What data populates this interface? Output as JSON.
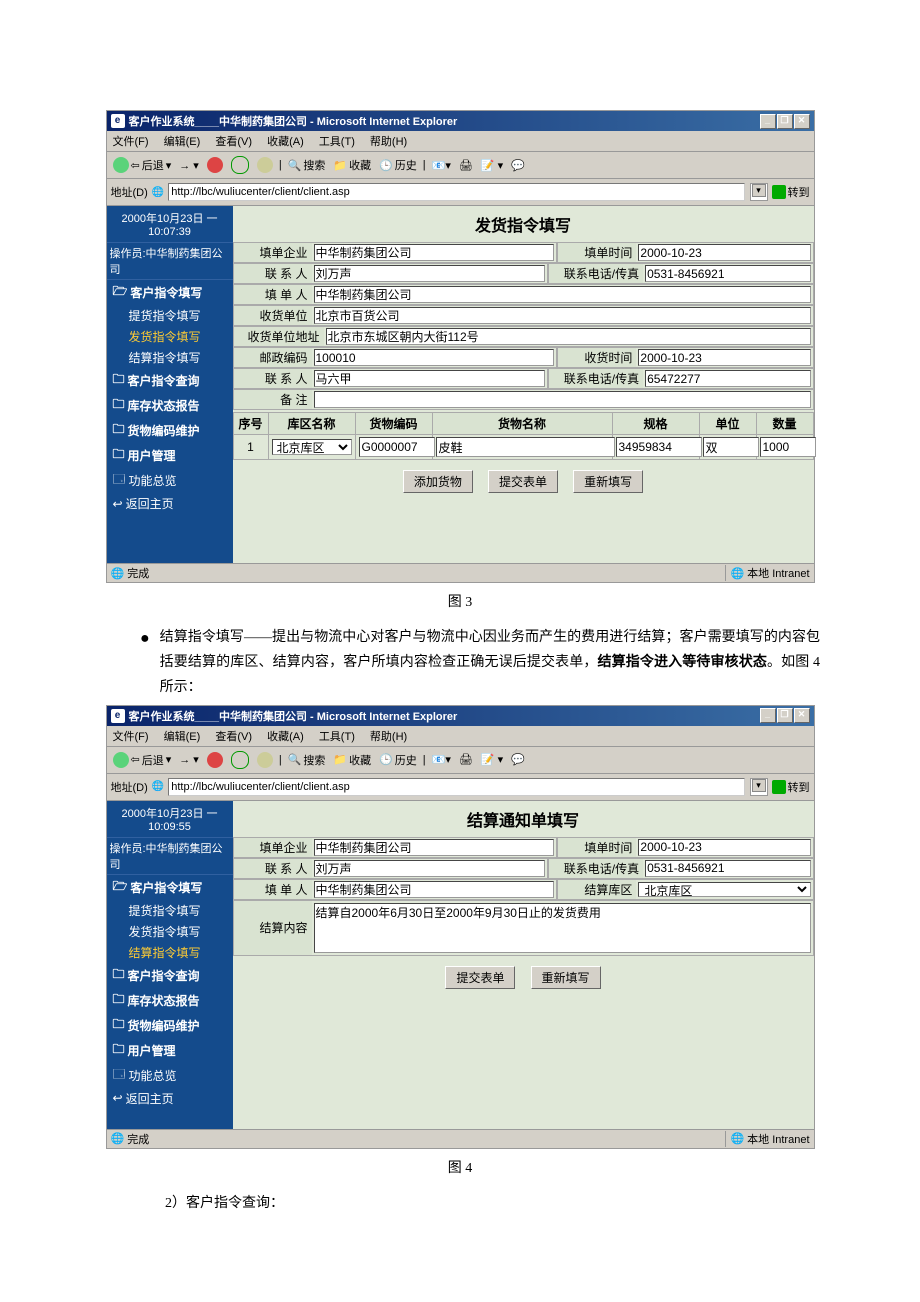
{
  "figure1": {
    "browser": {
      "title": "客户作业系统____中华制药集团公司 - Microsoft Internet Explorer",
      "menus": {
        "file": "文件(F)",
        "edit": "编辑(E)",
        "view": "查看(V)",
        "fav": "收藏(A)",
        "tools": "工具(T)",
        "help": "帮助(H)"
      },
      "toolbar": {
        "back": "后退",
        "search": "搜索",
        "favs": "收藏",
        "hist": "历史"
      },
      "address_label": "地址(D)",
      "url": "http://lbc/wuliucenter/client/client.asp",
      "go": "转到",
      "status": "完成",
      "zone": "本地 Intranet"
    },
    "sidebar": {
      "date": "2000年10月23日 一",
      "time": "10:07:39",
      "operator": "操作员:中华制药集团公司",
      "items": [
        {
          "label": "客户指令填写",
          "bold": true
        },
        {
          "label": "提货指令填写",
          "sub": true
        },
        {
          "label": "发货指令填写",
          "sub": true,
          "active": true
        },
        {
          "label": "结算指令填写",
          "sub": true
        },
        {
          "label": "客户指令查询",
          "bold": true
        },
        {
          "label": "库存状态报告",
          "bold": true
        },
        {
          "label": "货物编码维护",
          "bold": true
        },
        {
          "label": "用户管理",
          "bold": true
        },
        {
          "label": "功能总览"
        },
        {
          "label": "返回主页"
        }
      ]
    },
    "form": {
      "title": "发货指令填写",
      "fields": {
        "company_lbl": "填单企业",
        "company": "中华制药集团公司",
        "time_lbl": "填单时间",
        "time": "2000-10-23",
        "contact_lbl": "联 系 人",
        "contact": "刘万声",
        "phone_lbl": "联系电话/传真",
        "phone": "0531-8456921",
        "filler_lbl": "填 单 人",
        "filler": "中华制药集团公司",
        "recv_unit_lbl": "收货单位",
        "recv_unit": "北京市百货公司",
        "recv_addr_lbl": "收货单位地址",
        "recv_addr": "北京市东城区朝内大街112号",
        "zip_lbl": "邮政编码",
        "zip": "100010",
        "recv_time_lbl": "收货时间",
        "recv_time": "2000-10-23",
        "contact2_lbl": "联 系 人",
        "contact2": "马六甲",
        "phone2_lbl": "联系电话/传真",
        "phone2": "65472277",
        "remark_lbl": "备    注",
        "remark": ""
      },
      "grid": {
        "headers": {
          "no": "序号",
          "area": "库区名称",
          "code": "货物编码",
          "name": "货物名称",
          "spec": "规格",
          "unit": "单位",
          "qty": "数量"
        },
        "row": {
          "no": "1",
          "area": "北京库区",
          "code": "G0000007",
          "name": "皮鞋",
          "spec": "34959834",
          "unit": "双",
          "qty": "1000"
        }
      },
      "buttons": {
        "add": "添加货物",
        "submit": "提交表单",
        "reset": "重新填写"
      }
    },
    "caption": "图 3"
  },
  "paragraph1": "结算指令填写——提出与物流中心对客户与物流中心因业务而产生的费用进行结算；客户需要填写的内容包括要结算的库区、结算内容，客户所填内容检查正确无误后提交表单，",
  "paragraph1_bold": "结算指令进入等待审核状态",
  "paragraph1_tail": "。如图 4 所示：",
  "figure2": {
    "browser": {
      "title": "客户作业系统____中华制药集团公司 - Microsoft Internet Explorer",
      "menus": {
        "file": "文件(F)",
        "edit": "编辑(E)",
        "view": "查看(V)",
        "fav": "收藏(A)",
        "tools": "工具(T)",
        "help": "帮助(H)"
      },
      "toolbar": {
        "back": "后退",
        "search": "搜索",
        "favs": "收藏",
        "hist": "历史"
      },
      "address_label": "地址(D)",
      "url": "http://lbc/wuliucenter/client/client.asp",
      "go": "转到",
      "status": "完成",
      "zone": "本地 Intranet"
    },
    "sidebar": {
      "date": "2000年10月23日 一",
      "time": "10:09:55",
      "operator": "操作员:中华制药集团公司",
      "items": [
        {
          "label": "客户指令填写",
          "bold": true
        },
        {
          "label": "提货指令填写",
          "sub": true
        },
        {
          "label": "发货指令填写",
          "sub": true
        },
        {
          "label": "结算指令填写",
          "sub": true,
          "active": true
        },
        {
          "label": "客户指令查询",
          "bold": true
        },
        {
          "label": "库存状态报告",
          "bold": true
        },
        {
          "label": "货物编码维护",
          "bold": true
        },
        {
          "label": "用户管理",
          "bold": true
        },
        {
          "label": "功能总览"
        },
        {
          "label": "返回主页"
        }
      ]
    },
    "form": {
      "title": "结算通知单填写",
      "fields": {
        "company_lbl": "填单企业",
        "company": "中华制药集团公司",
        "time_lbl": "填单时间",
        "time": "2000-10-23",
        "contact_lbl": "联 系 人",
        "contact": "刘万声",
        "phone_lbl": "联系电话/传真",
        "phone": "0531-8456921",
        "filler_lbl": "填 单 人",
        "filler": "中华制药集团公司",
        "area_lbl": "结算库区",
        "area": "北京库区",
        "content_lbl": "结算内容",
        "content": "结算自2000年6月30日至2000年9月30日止的发货费用"
      },
      "buttons": {
        "submit": "提交表单",
        "reset": "重新填写"
      }
    },
    "caption": "图 4"
  },
  "paragraph2": "2）客户指令查询："
}
